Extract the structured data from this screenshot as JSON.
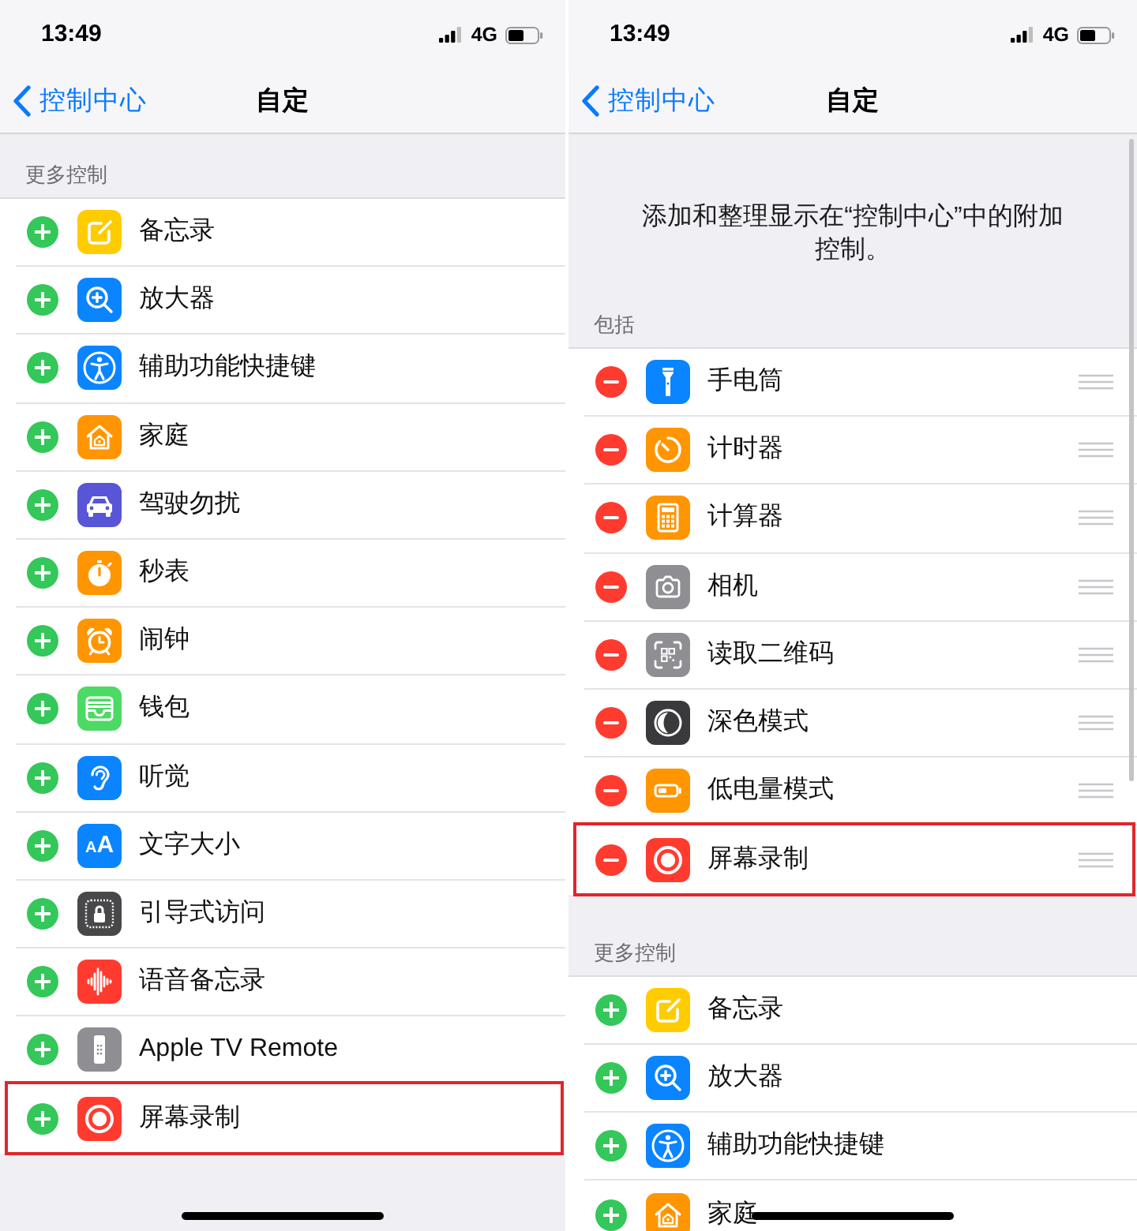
{
  "screens": [
    {
      "status_bar": {
        "time": "13:49",
        "network": "4G"
      },
      "nav": {
        "back": "控制中心",
        "title": "自定"
      },
      "scroll_indicator": false,
      "sections": [
        {
          "header": "更多控制",
          "kind": "available",
          "items": [
            {
              "label": "备忘录",
              "kind": "notes",
              "highlighted": false
            },
            {
              "label": "放大器",
              "kind": "magnifier",
              "highlighted": false
            },
            {
              "label": "辅助功能快捷键",
              "kind": "accessibility",
              "highlighted": false
            },
            {
              "label": "家庭",
              "kind": "home",
              "highlighted": false
            },
            {
              "label": "驾驶勿扰",
              "kind": "driving",
              "highlighted": false
            },
            {
              "label": "秒表",
              "kind": "stopwatch",
              "highlighted": false
            },
            {
              "label": "闹钟",
              "kind": "alarm",
              "highlighted": false
            },
            {
              "label": "钱包",
              "kind": "wallet",
              "highlighted": false
            },
            {
              "label": "听觉",
              "kind": "hearing",
              "highlighted": false
            },
            {
              "label": "文字大小",
              "kind": "text_size",
              "glyph": "AA",
              "highlighted": false
            },
            {
              "label": "引导式访问",
              "kind": "guided_access",
              "highlighted": false
            },
            {
              "label": "语音备忘录",
              "kind": "voice_memos",
              "highlighted": false
            },
            {
              "label": "Apple TV Remote",
              "kind": "remote",
              "highlighted": false
            },
            {
              "label": "屏幕录制",
              "kind": "screen_recording",
              "highlighted": true
            }
          ]
        }
      ]
    },
    {
      "status_bar": {
        "time": "13:49",
        "network": "4G"
      },
      "nav": {
        "back": "控制中心",
        "title": "自定"
      },
      "scroll_indicator": true,
      "description": "添加和整理显示在“控制中心”中的附加控制。",
      "sections": [
        {
          "header": "包括",
          "kind": "included",
          "items": [
            {
              "label": "手电筒",
              "kind": "flashlight",
              "highlighted": false
            },
            {
              "label": "计时器",
              "kind": "timer",
              "highlighted": false
            },
            {
              "label": "计算器",
              "kind": "calculator",
              "highlighted": false
            },
            {
              "label": "相机",
              "kind": "camera",
              "highlighted": false
            },
            {
              "label": "读取二维码",
              "kind": "qr_code",
              "highlighted": false
            },
            {
              "label": "深色模式",
              "kind": "dark_mode",
              "highlighted": false
            },
            {
              "label": "低电量模式",
              "kind": "low_power",
              "highlighted": false
            },
            {
              "label": "屏幕录制",
              "kind": "screen_recording",
              "highlighted": true
            }
          ]
        },
        {
          "header": "更多控制",
          "kind": "available",
          "items": [
            {
              "label": "备忘录",
              "kind": "notes",
              "highlighted": false
            },
            {
              "label": "放大器",
              "kind": "magnifier",
              "highlighted": false
            },
            {
              "label": "辅助功能快捷键",
              "kind": "accessibility",
              "highlighted": false
            },
            {
              "label": "家庭",
              "kind": "home",
              "highlighted": false
            }
          ]
        }
      ]
    }
  ]
}
